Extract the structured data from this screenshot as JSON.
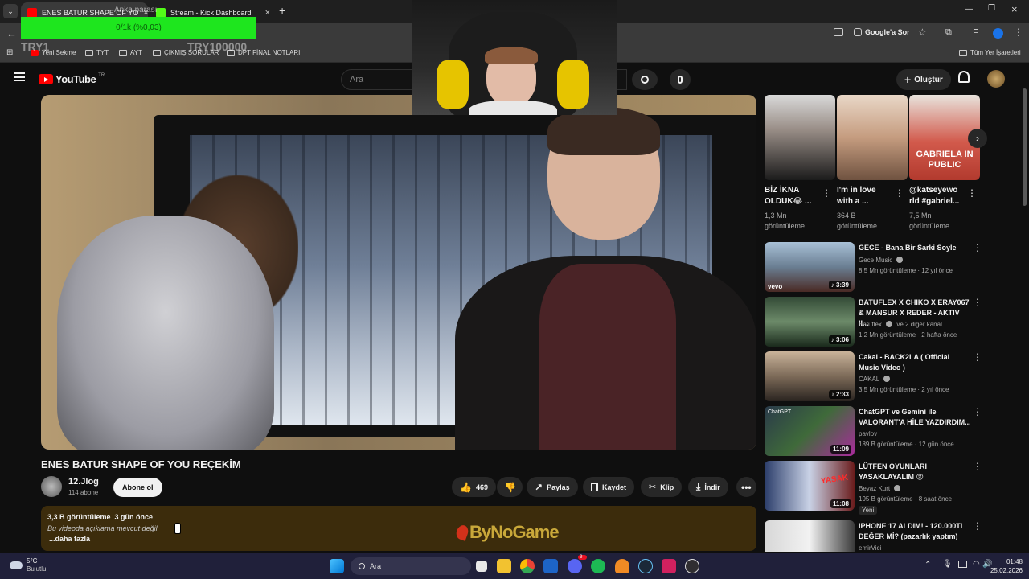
{
  "browser": {
    "tabs": [
      {
        "title": "ENES BATUR SHAPE OF YO",
        "active": true
      },
      {
        "title": "Stream - Kick Dashboard",
        "active": false
      }
    ],
    "new_tab": "+",
    "toolbar": {
      "google_lens": "Google'a Sor"
    },
    "bookmarks": [
      "Yeni Sekme",
      "TYT",
      "AYT",
      "ÇIKMIŞ SORULAR",
      "DPT FİNAL NOTLARI"
    ],
    "all_bookmarks": "Tüm Yer İşaretleri"
  },
  "stream_overlay": {
    "goal_label_1": "TRY1",
    "goal_label_2": "TRY100000",
    "goal_bar_text": "0/1k (%0,03)",
    "top_text": "Anka parası"
  },
  "youtube": {
    "logo": "YouTube",
    "region": "TR",
    "search_placeholder": "Ara",
    "create_label": "Oluştur",
    "video": {
      "title": "ENES BATUR SHAPE OF YOU REÇEKİM",
      "channel": "12.Jlog",
      "subscribers": "114 abone",
      "subscribe_label": "Abone ol",
      "likes": "469",
      "share_label": "Paylaş",
      "save_label": "Kaydet",
      "clip_label": "Klip",
      "download_label": "İndir",
      "views_date": "3,3 B görüntüleme  3 gün önce",
      "description": "Bu videoda açıklama mevcut değil.",
      "more_label": "...daha fazla",
      "overlay_brand": "ByNoGame"
    },
    "shorts": [
      {
        "title_line1": "BİZ İKNA",
        "title_line2": "OLDUK😂 ...",
        "views_line1": "1,3 Mn",
        "views_line2": "görüntüleme"
      },
      {
        "title_line1": "I'm in love",
        "title_line2": "with a ...",
        "views_line1": "364 B",
        "views_line2": "görüntüleme"
      },
      {
        "title_line1": "@katseyewo",
        "title_line2": "rld #gabriel...",
        "views_line1": "7,5 Mn",
        "views_line2": "görüntüleme",
        "thumb_text": "GABRIELA IN PUBLIC"
      }
    ],
    "related": [
      {
        "title": "GECE - Bana Bir Sarki Soyle",
        "channel": "Gece Music",
        "meta": "8,5 Mn görüntüleme · 12 yıl önce",
        "duration": "3:39",
        "badge": "vevo"
      },
      {
        "title": "BATUFLEX X CHIKO X ERAY067 & MANSUR X REDER - AKTIV II...",
        "channel": "Batuflex",
        "channel_extra": "ve 2 diğer kanal",
        "meta": "1,2 Mn görüntüleme · 2 hafta önce",
        "duration": "3:06"
      },
      {
        "title": "Cakal - BACK2LA ( Official Music Video )",
        "channel": "CAKAL",
        "meta": "3,5 Mn görüntüleme · 2 yıl önce",
        "duration": "2:33"
      },
      {
        "title": "ChatGPT ve Gemini ile VALORANT'A HİLE YAZDIRDIM...",
        "channel": "pavlov",
        "meta": "189 B görüntüleme · 12 gün önce",
        "duration": "11:09",
        "thumb_text": "ChatGPT"
      },
      {
        "title": "LÜTFEN OYUNLARI YASAKLAYALIM 😡",
        "channel": "Beyaz Kurt",
        "meta": "195 B görüntüleme · 8 saat önce",
        "duration": "11:08",
        "tag": "Yeni",
        "thumb_text": "YASAK"
      },
      {
        "title": "iPHONE 17 ALDIM! - 120.000TL DEĞER Mİ? (pazarlık yaptım)",
        "channel": "emirVici",
        "meta": "",
        "duration": ""
      }
    ]
  },
  "taskbar": {
    "weather_temp": "5°C",
    "weather_desc": "Bulutlu",
    "search_label": "Ara",
    "time": "01:48",
    "date": "25.02.2026",
    "badge_count": "9+"
  },
  "colors": {
    "goal_bar": "#1ee61e",
    "youtube_red": "#ff0000",
    "desc_bg": "#3c2c0c",
    "taskbar": "#20203a"
  }
}
